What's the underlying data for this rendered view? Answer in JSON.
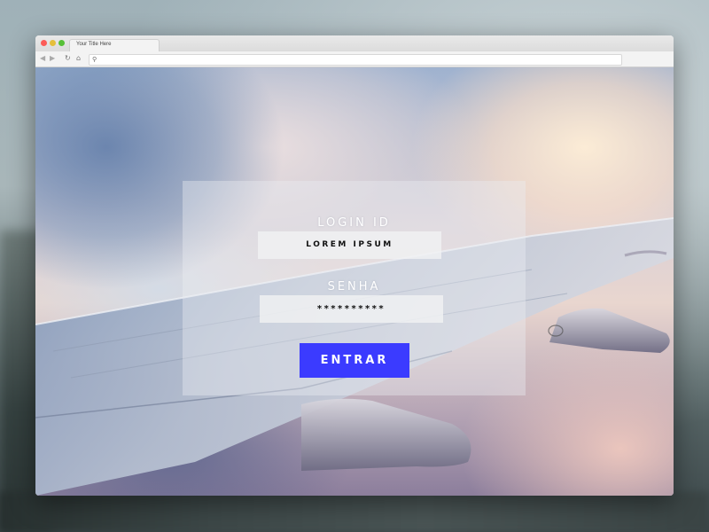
{
  "browser": {
    "tab_title": "Your Title Here",
    "url": "",
    "icons": {
      "back": "back-arrow-icon",
      "forward": "forward-arrow-icon",
      "reload": "reload-icon",
      "home": "home-icon",
      "search": "search-icon"
    }
  },
  "login": {
    "login_label": "LOGIN ID",
    "login_value": "LOREM IPSUM",
    "password_label": "SENHA",
    "password_value": "**********",
    "submit_label": "ENTRAR"
  },
  "colors": {
    "button": "#3b3bff",
    "panel_overlay": "rgba(236,238,242,0.40)"
  }
}
